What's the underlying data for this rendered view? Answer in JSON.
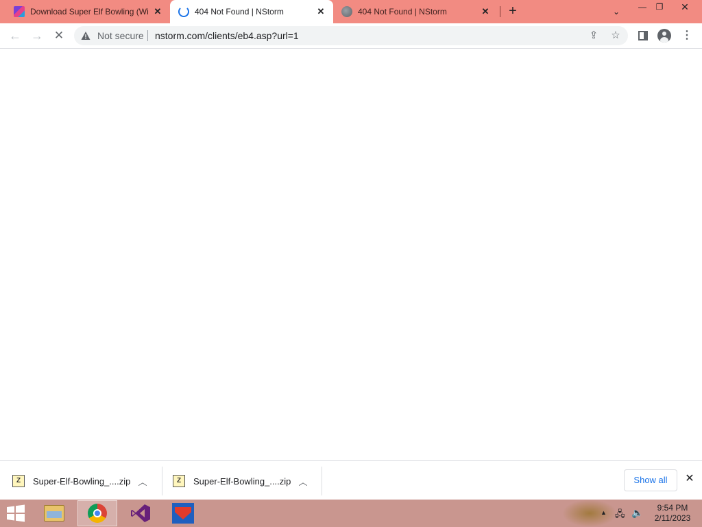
{
  "browser": {
    "tabs": [
      {
        "title": "Download Super Elf Bowling (Wi",
        "favicon": "app-icon",
        "active": false
      },
      {
        "title": "404 Not Found | NStorm",
        "favicon": "loading-spinner-icon",
        "active": true
      },
      {
        "title": "404 Not Found | NStorm",
        "favicon": "globe-icon",
        "active": false
      }
    ],
    "new_tab_label": "+",
    "toolbar": {
      "security_label": "Not secure",
      "url": "nstorm.com/clients/eb4.asp?url=1"
    }
  },
  "downloads": {
    "items": [
      {
        "name": "Super-Elf-Bowling_....zip"
      },
      {
        "name": "Super-Elf-Bowling_....zip"
      }
    ],
    "show_all_label": "Show all"
  },
  "taskbar": {
    "apps": [
      "File Explorer",
      "Google Chrome",
      "Visual Studio",
      "Superman"
    ],
    "clock": {
      "time": "9:54 PM",
      "date": "2/11/2023"
    }
  },
  "colors": {
    "tabstrip": "#f28b82",
    "taskbar": "#c9968f",
    "accent": "#1a73e8"
  }
}
